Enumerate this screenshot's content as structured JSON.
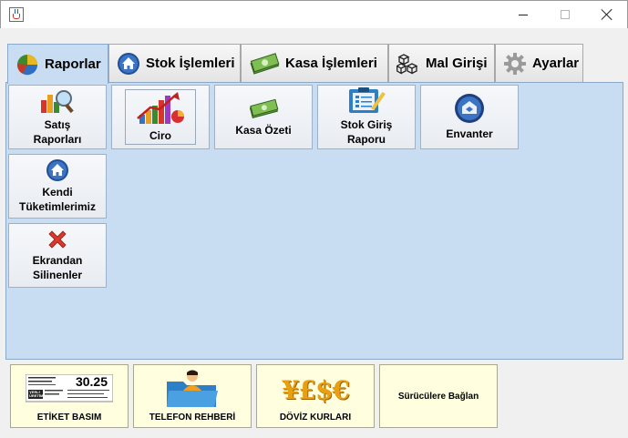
{
  "window": {
    "icon": "java-cup-icon",
    "controls": [
      "minimize",
      "maximize",
      "close"
    ]
  },
  "tabs": [
    {
      "label": "Raporlar",
      "icon": "pie-chart-icon",
      "active": true
    },
    {
      "label": "Stok İşlemleri",
      "icon": "home-icon",
      "active": false
    },
    {
      "label": "Kasa İşlemleri",
      "icon": "money-icon",
      "active": false
    },
    {
      "label": "Mal Girişi",
      "icon": "boxes-icon",
      "active": false
    },
    {
      "label": "Ayarlar",
      "icon": "gear-icon",
      "active": false
    }
  ],
  "report_buttons": [
    {
      "label": "Satış\nRaporları",
      "icon": "chart-magnifier-icon"
    },
    {
      "label": "Ciro",
      "icon": "growth-chart-icon"
    },
    {
      "label": "Kasa Özeti",
      "icon": "money-icon"
    },
    {
      "label": "Stok Giriş\nRaporu",
      "icon": "clipboard-icon"
    },
    {
      "label": "Envanter",
      "icon": "envanter-icon"
    },
    {
      "label": "Kendi\nTüketimlerimiz",
      "icon": "home-icon"
    },
    {
      "label": "Ekrandan\nSilinenler",
      "icon": "red-x-icon"
    }
  ],
  "bottom_buttons": [
    {
      "label": "ETİKET BASIM",
      "icon": "price-label-icon",
      "label_text": {
        "price": "30.25",
        "brand": "YERLİ ÜRETİM"
      }
    },
    {
      "label": "TELEFON REHBERİ",
      "icon": "phonebook-folder-icon"
    },
    {
      "label": "DÖVİZ KURLARI",
      "icon": "currency-symbols-icon",
      "symbols": "¥£$€"
    },
    {
      "label": "Sürücülere Bağlan",
      "icon": ""
    }
  ],
  "colors": {
    "panel": "#c8ddf2",
    "bottom_button": "#ffffe0"
  }
}
